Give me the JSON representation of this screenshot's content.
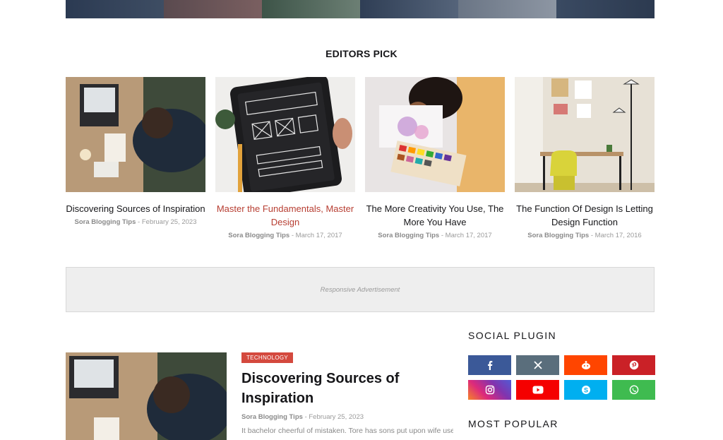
{
  "colors": {
    "accent": "#b73e32",
    "badge": "#d4493e",
    "facebook": "#3b5998",
    "twitter_x": "#5a6e7c",
    "reddit": "#ff4500",
    "pinterest": "#ca2127",
    "instagram": "#8f3ab2",
    "youtube": "#f50000",
    "skype": "#00aff0",
    "whatsapp": "#3fbb50"
  },
  "editors_pick": {
    "title": "EDITORS PICK",
    "posts": [
      {
        "title": "Discovering Sources of Inspiration",
        "author": "Sora Blogging Tips",
        "separator": "-",
        "date": "February 25, 2023"
      },
      {
        "title": "Master the Fundamentals, Master Design",
        "author": "Sora Blogging Tips",
        "separator": "-",
        "date": "March 17, 2017"
      },
      {
        "title": "The More Creativity You Use, The More You Have",
        "author": "Sora Blogging Tips",
        "separator": "-",
        "date": "March 17, 2017"
      },
      {
        "title": "The Function Of Design Is Letting Design Function",
        "author": "Sora Blogging Tips",
        "separator": "-",
        "date": "March 17, 2016"
      }
    ]
  },
  "advertisement": {
    "label": "Responsive Advertisement"
  },
  "featured": {
    "category": "TECHNOLOGY",
    "title": "Discovering Sources of Inspiration",
    "author": "Sora Blogging Tips",
    "separator": "-",
    "date": "February 25, 2023",
    "excerpt": "It bachelor cheerful of mistaken. Tore has sons put upon wife use"
  },
  "sidebar": {
    "social_heading": "SOCIAL PLUGIN",
    "popular_heading": "MOST POPULAR",
    "social": [
      {
        "icon": "facebook-icon"
      },
      {
        "icon": "x-twitter-icon"
      },
      {
        "icon": "reddit-icon"
      },
      {
        "icon": "pinterest-icon"
      },
      {
        "icon": "instagram-icon"
      },
      {
        "icon": "youtube-icon"
      },
      {
        "icon": "skype-icon"
      },
      {
        "icon": "whatsapp-icon"
      }
    ]
  }
}
